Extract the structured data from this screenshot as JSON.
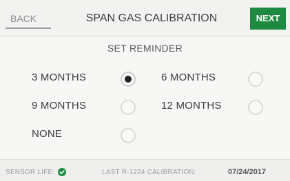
{
  "header": {
    "back_label": "BACK",
    "title": "SPAN GAS CALIBRATION",
    "next_label": "NEXT"
  },
  "reminder": {
    "heading": "SET REMINDER",
    "options": [
      {
        "label": "3 MONTHS",
        "selected": true
      },
      {
        "label": "6 MONTHS",
        "selected": false
      },
      {
        "label": "9 MONTHS",
        "selected": false
      },
      {
        "label": "12 MONTHS",
        "selected": false
      },
      {
        "label": "NONE",
        "selected": false
      }
    ]
  },
  "footer": {
    "sensor_life_label": "SENSOR LIFE:",
    "sensor_life_icon": "check-circle-icon",
    "last_calibration_label": "LAST R-1224 CALIBRATION:",
    "last_calibration_date": "07/24/2017"
  },
  "colors": {
    "accent_green": "#1e8a41",
    "status_ok": "#1e8a41"
  }
}
